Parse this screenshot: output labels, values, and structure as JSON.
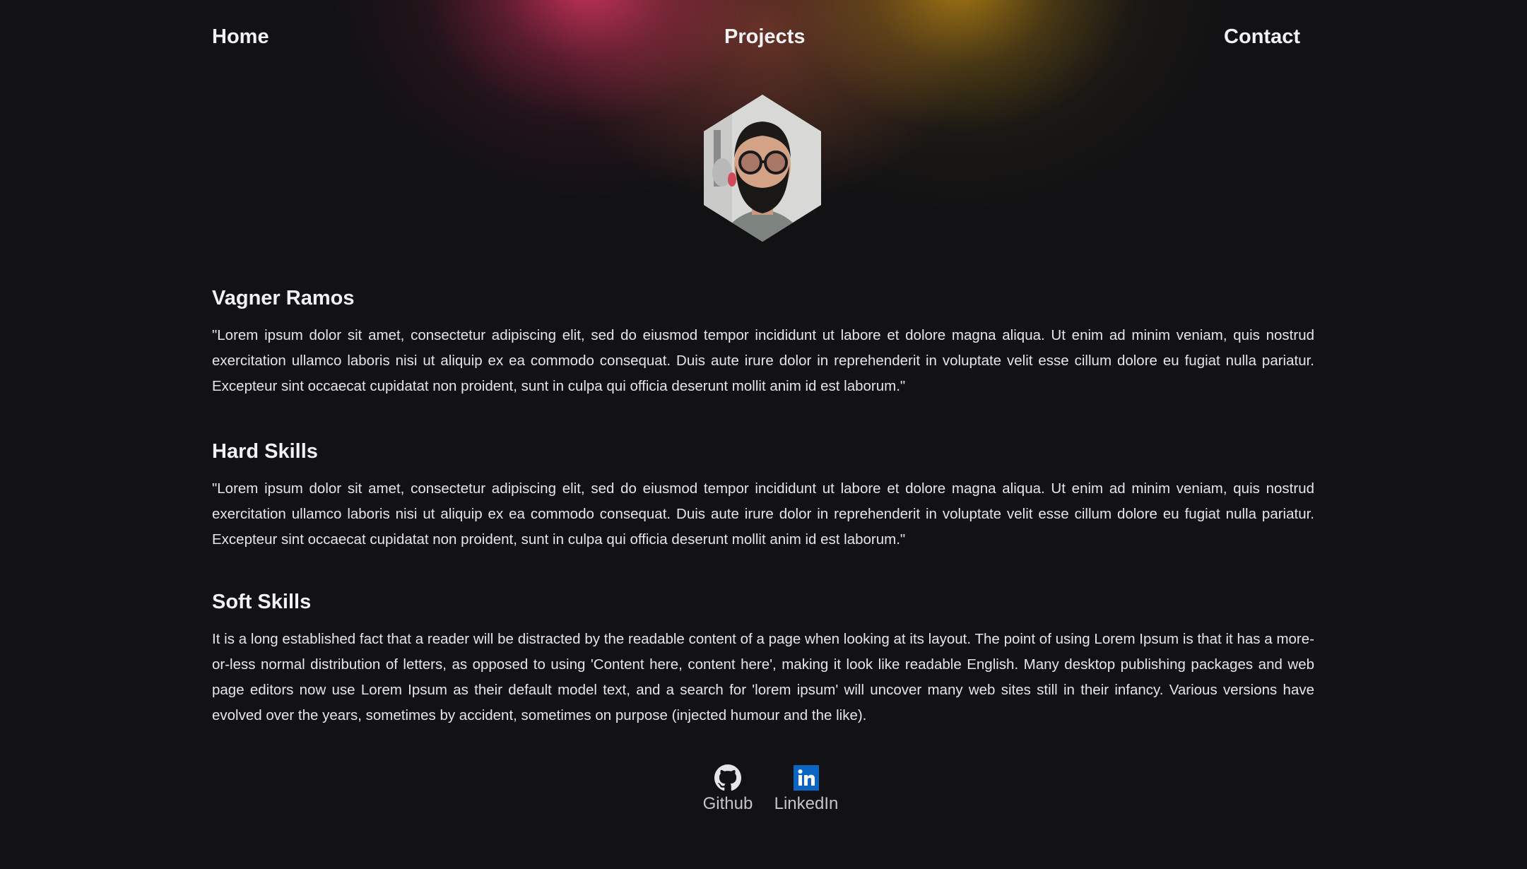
{
  "nav": {
    "home": "Home",
    "projects": "Projects",
    "contact": "Contact"
  },
  "profile": {
    "name": "Vagner Ramos",
    "bio": "\"Lorem ipsum dolor sit amet, consectetur adipiscing elit, sed do eiusmod tempor incididunt ut labore et dolore magna aliqua. Ut enim ad minim veniam, quis nostrud exercitation ullamco laboris nisi ut aliquip ex ea commodo consequat. Duis aute irure dolor in reprehenderit in voluptate velit esse cillum dolore eu fugiat nulla pariatur. Excepteur sint occaecat cupidatat non proident, sunt in culpa qui officia deserunt mollit anim id est laborum.\""
  },
  "hard_skills": {
    "title": "Hard Skills",
    "text": "\"Lorem ipsum dolor sit amet, consectetur adipiscing elit, sed do eiusmod tempor incididunt ut labore et dolore magna aliqua. Ut enim ad minim veniam, quis nostrud exercitation ullamco laboris nisi ut aliquip ex ea commodo consequat. Duis aute irure dolor in reprehenderit in voluptate velit esse cillum dolore eu fugiat nulla pariatur. Excepteur sint occaecat cupidatat non proident, sunt in culpa qui officia deserunt mollit anim id est laborum.\""
  },
  "soft_skills": {
    "title": "Soft Skills",
    "text": "It is a long established fact that a reader will be distracted by the readable content of a page when looking at its layout. The point of using Lorem Ipsum is that it has a more-or-less normal distribution of letters, as opposed to using 'Content here, content here', making it look like readable English. Many desktop publishing packages and web page editors now use Lorem Ipsum as their default model text, and a search for 'lorem ipsum' will uncover many web sites still in their infancy. Various versions have evolved over the years, sometimes by accident, sometimes on purpose (injected humour and the like)."
  },
  "social": [
    {
      "label": "Github",
      "icon": "github-icon"
    },
    {
      "label": "LinkedIn",
      "icon": "linkedin-icon"
    }
  ],
  "colors": {
    "background": "#121214",
    "glow_pink": "#de3660",
    "glow_gold": "#c48c14",
    "linkedin_blue": "#0a66c2"
  }
}
